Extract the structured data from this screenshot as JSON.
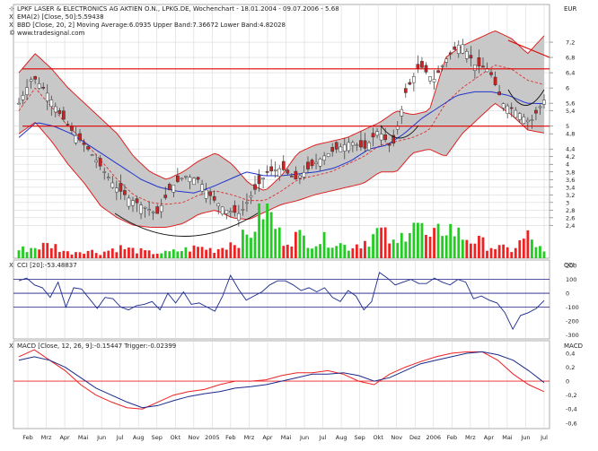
{
  "header": {
    "title_line": "LPKF LASER & ELECTRONICS AG AKTIEN O.N., LPKG.DE, Wochenchart - 18.01.2004 - 09.07.2006 - 5.68",
    "ema_line": "EMA(2) [Close, 50]:5.59438",
    "bbd_line": "BBD [Close, 20, 2] Moving Average:6.0935 Upper Band:7.36672 Lower Band:4.82028",
    "source_line": "www.tradesignal.com",
    "currency": "EUR"
  },
  "colors": {
    "candle_up": "#22aa22",
    "candle_down": "#cc2222",
    "band_fill": "#c8c8c8",
    "band_edge": "#dd2222",
    "ema": "#2233cc",
    "ma": "#dd2222",
    "volume_up": "#22cc22",
    "volume_down": "#ee2222",
    "hline": "#dd0000",
    "cci": "#1a2a8a",
    "macd": "#1a2a8a",
    "trigger": "#ee2222",
    "grid": "#d8d8d8",
    "bg": "#ffffff"
  },
  "chart_data": [
    {
      "type": "candlestick",
      "panel": "price",
      "ylim": [
        2.15,
        7.6
      ],
      "y_ticks": [
        "7,2",
        "6,8",
        "6,4",
        "6",
        "5,6",
        "5,4",
        "5",
        "4,8",
        "4,4",
        "4,2",
        "4",
        "3,8",
        "3,6",
        "3,4",
        "3,2",
        "3",
        "2,8",
        "2,6",
        "2,4"
      ],
      "y_tick_values": [
        7.2,
        6.8,
        6.4,
        6.0,
        5.6,
        5.4,
        5.0,
        4.8,
        4.4,
        4.2,
        4.0,
        3.8,
        3.6,
        3.4,
        3.2,
        3.0,
        2.8,
        2.6,
        2.4
      ],
      "x_ticks": [
        "Feb",
        "Mrz",
        "Apr",
        "Mai",
        "Jun",
        "Jul",
        "Aug",
        "Sep",
        "Okt",
        "Nov",
        "2005",
        "Feb",
        "Mrz",
        "Apr",
        "Mai",
        "Jun",
        "Jul",
        "Aug",
        "Sep",
        "Okt",
        "Nov",
        "Dez",
        "2006",
        "Feb",
        "Mrz",
        "Apr",
        "Mai",
        "Jun",
        "Jul"
      ],
      "horizontal_lines": [
        6.5,
        5.0
      ],
      "close_anchors": [
        5.6,
        6.3,
        5.9,
        5.3,
        4.8,
        4.4,
        3.9,
        3.4,
        3.1,
        2.9,
        2.7,
        3.4,
        3.7,
        3.6,
        3.1,
        2.8,
        2.7,
        3.3,
        3.8,
        3.9,
        3.6,
        3.9,
        4.2,
        4.4,
        4.6,
        4.4,
        4.9,
        4.4,
        5.9,
        6.6,
        6.2,
        6.8,
        7.2,
        6.6,
        6.5,
        5.6,
        5.4,
        5.1,
        5.68
      ],
      "ema_anchors": [
        4.7,
        5.1,
        5.0,
        4.8,
        4.5,
        4.2,
        3.9,
        3.6,
        3.4,
        3.3,
        3.25,
        3.4,
        3.6,
        3.8,
        3.7,
        3.7,
        3.75,
        3.8,
        3.9,
        4.1,
        4.4,
        4.5,
        4.8,
        5.2,
        5.5,
        5.8,
        5.9,
        5.9,
        5.8,
        5.6,
        5.59
      ],
      "ma_anchors": [
        5.4,
        6.0,
        5.5,
        5.0,
        4.6,
        4.1,
        3.6,
        3.2,
        3.0,
        2.95,
        3.0,
        3.2,
        3.3,
        3.2,
        3.05,
        3.05,
        3.3,
        3.6,
        3.7,
        3.8,
        4.0,
        4.2,
        4.5,
        4.6,
        4.7,
        4.9,
        5.6,
        6.0,
        6.3,
        6.6,
        6.5,
        6.2,
        6.09
      ],
      "upper_band_anchors": [
        6.4,
        6.9,
        6.5,
        6.0,
        5.6,
        5.2,
        4.8,
        4.2,
        3.8,
        3.6,
        3.8,
        4.1,
        4.3,
        4.0,
        3.5,
        3.3,
        3.7,
        4.3,
        4.5,
        4.6,
        4.7,
        4.9,
        5.1,
        5.4,
        5.3,
        5.4,
        6.8,
        7.1,
        7.3,
        7.5,
        7.3,
        6.9,
        7.37
      ],
      "lower_band_anchors": [
        4.8,
        5.1,
        4.6,
        4.0,
        3.5,
        2.9,
        2.6,
        2.4,
        2.35,
        2.35,
        2.45,
        2.7,
        2.8,
        2.6,
        2.55,
        2.75,
        2.95,
        3.05,
        3.2,
        3.3,
        3.4,
        3.5,
        3.8,
        3.8,
        4.3,
        4.4,
        4.2,
        4.8,
        5.2,
        5.6,
        5.3,
        4.9,
        4.82
      ]
    },
    {
      "type": "bar",
      "panel": "volume",
      "note": "relative volume per week, 0-1",
      "values_anchors": [
        0.15,
        0.2,
        0.25,
        0.1,
        0.15,
        0.1,
        0.2,
        0.15,
        0.1,
        0.1,
        0.15,
        0.2,
        0.15,
        0.3,
        0.4,
        1.0,
        0.35,
        0.4,
        0.3,
        0.35,
        0.2,
        0.3,
        0.5,
        0.2,
        0.8,
        0.3,
        0.6,
        0.4,
        0.3,
        0.2,
        0.15,
        0.4,
        0.1
      ]
    },
    {
      "type": "line",
      "panel": "cci",
      "title": "CCI [20]:-53.48837",
      "label": "CCI",
      "ylim": [
        -330,
        240
      ],
      "y_ticks": [
        "200",
        "100",
        "0",
        "-100",
        "-200",
        "-300"
      ],
      "y_tick_values": [
        200,
        100,
        0,
        -100,
        -200,
        -300
      ],
      "reference_lines": [
        100,
        0,
        -100
      ],
      "series": [
        {
          "name": "CCI",
          "values": [
            90,
            110,
            60,
            40,
            -30,
            80,
            -100,
            40,
            30,
            -40,
            -110,
            -30,
            -40,
            -100,
            -120,
            -90,
            -80,
            -60,
            -120,
            0,
            -70,
            10,
            -80,
            -70,
            -100,
            -130,
            -20,
            130,
            30,
            -50,
            -20,
            10,
            60,
            90,
            90,
            60,
            20,
            40,
            10,
            40,
            -30,
            -60,
            20,
            -20,
            -120,
            -60,
            150,
            110,
            60,
            80,
            100,
            70,
            70,
            110,
            80,
            60,
            100,
            80,
            -40,
            -20,
            -50,
            -70,
            -140,
            -260,
            -160,
            -140,
            -110,
            -53
          ]
        }
      ]
    },
    {
      "type": "line",
      "panel": "macd",
      "title": "MACD [Close, 12, 26, 9]:-0.15447 Trigger:-0.02399",
      "label": "MACD",
      "ylim": [
        -0.68,
        0.58
      ],
      "y_ticks": [
        "0,4",
        "0,2",
        "0",
        "-0,2",
        "-0,4",
        "-0,6"
      ],
      "y_tick_values": [
        0.4,
        0.2,
        0.0,
        -0.2,
        -0.4,
        -0.6
      ],
      "reference_lines": [
        0
      ],
      "series": [
        {
          "name": "MACD",
          "values": [
            0.3,
            0.35,
            0.3,
            0.2,
            0.05,
            -0.1,
            -0.2,
            -0.3,
            -0.38,
            -0.35,
            -0.28,
            -0.22,
            -0.18,
            -0.15,
            -0.1,
            -0.08,
            -0.05,
            0.0,
            0.05,
            0.1,
            0.1,
            0.12,
            0.08,
            0.0,
            0.05,
            0.15,
            0.25,
            0.3,
            0.35,
            0.4,
            0.42,
            0.38,
            0.3,
            0.15,
            -0.02
          ]
        },
        {
          "name": "Trigger",
          "values": [
            0.35,
            0.45,
            0.3,
            0.15,
            -0.05,
            -0.2,
            -0.3,
            -0.38,
            -0.4,
            -0.3,
            -0.2,
            -0.15,
            -0.12,
            -0.05,
            0.0,
            0.0,
            0.02,
            0.08,
            0.12,
            0.12,
            0.15,
            0.1,
            0.0,
            -0.05,
            0.1,
            0.2,
            0.28,
            0.35,
            0.4,
            0.42,
            0.42,
            0.3,
            0.1,
            -0.05,
            -0.15
          ]
        }
      ]
    }
  ]
}
